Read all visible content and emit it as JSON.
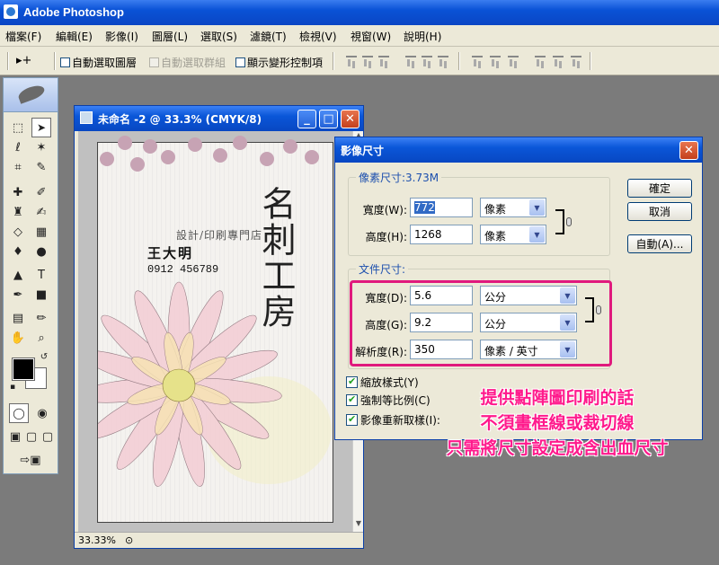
{
  "app": {
    "title": "Adobe Photoshop"
  },
  "menu": [
    {
      "label": "檔案(F)"
    },
    {
      "label": "編輯(E)"
    },
    {
      "label": "影像(I)"
    },
    {
      "label": "圖層(L)"
    },
    {
      "label": "選取(S)"
    },
    {
      "label": "濾鏡(T)"
    },
    {
      "label": "檢視(V)"
    },
    {
      "label": "視窗(W)"
    },
    {
      "label": "說明(H)"
    }
  ],
  "options": {
    "tool_arrow": "▸+",
    "auto_select_layer": "自動選取圖層",
    "auto_select_group": "自動選取群組",
    "show_transform": "顯示變形控制項"
  },
  "document": {
    "title": "未命名 -2 @ 33.3% (CMYK/8)",
    "zoom": "33.33%",
    "card": {
      "subtitle": "設計/印刷專門店",
      "name": "王大明",
      "phone": "0912 456789",
      "title": "名刺工房"
    }
  },
  "dialog": {
    "title": "影像尺寸",
    "pixel_group": "像素尺寸:3.73M",
    "width_label": "寬度(W):",
    "width_value": "772",
    "height_label": "高度(H):",
    "height_value": "1268",
    "pixel_unit": "像素",
    "doc_group": "文件尺寸:",
    "doc_width_label": "寬度(D):",
    "doc_width_value": "5.6",
    "doc_height_label": "高度(G):",
    "doc_height_value": "9.2",
    "doc_unit": "公分",
    "resolution_label": "解析度(R):",
    "resolution_value": "350",
    "resolution_unit": "像素 / 英寸",
    "ok": "確定",
    "cancel": "取消",
    "auto": "自動(A)...",
    "scale_styles": "縮放樣式(Y)",
    "constrain": "強制等比例(C)",
    "resample": "影像重新取樣(I):"
  },
  "annotation": {
    "line1": "提供點陣圖印刷的話",
    "line2": "不須畫框線或裁切線",
    "line3": "只需將尺寸設定成含出血尺寸",
    "color": "#ff1a8c"
  }
}
